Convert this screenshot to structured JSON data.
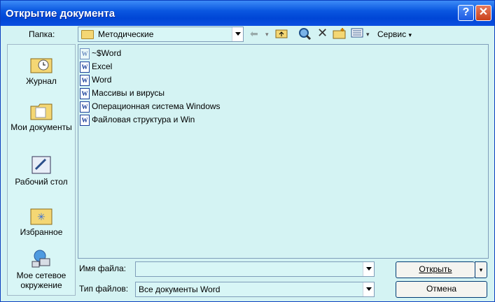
{
  "window": {
    "title": "Открытие документа"
  },
  "titlebar_buttons": {
    "help": "?",
    "close": "✕"
  },
  "folder": {
    "label": "Папка:",
    "value": "Методические"
  },
  "toolbar": {
    "service_label": "Сервис"
  },
  "places": [
    {
      "label": "Журнал"
    },
    {
      "label": "Мои документы"
    },
    {
      "label": "Рабочий стол"
    },
    {
      "label": "Избранное"
    },
    {
      "label": "Мое сетевое окружение"
    }
  ],
  "files": [
    {
      "name": "~$Word",
      "icon": "word-doc-faded-icon"
    },
    {
      "name": "Excel",
      "icon": "word-doc-icon"
    },
    {
      "name": "Word",
      "icon": "word-doc-icon"
    },
    {
      "name": "Массивы и вирусы",
      "icon": "word-doc-icon"
    },
    {
      "name": "Операционная система Windows",
      "icon": "word-doc-icon"
    },
    {
      "name": "Файловая структура и Win",
      "icon": "word-doc-icon"
    }
  ],
  "filename": {
    "label": "Имя файла:",
    "value": ""
  },
  "filetype": {
    "label": "Тип файлов:",
    "value": "Все документы Word"
  },
  "buttons": {
    "open": "Открыть",
    "cancel": "Отмена"
  }
}
